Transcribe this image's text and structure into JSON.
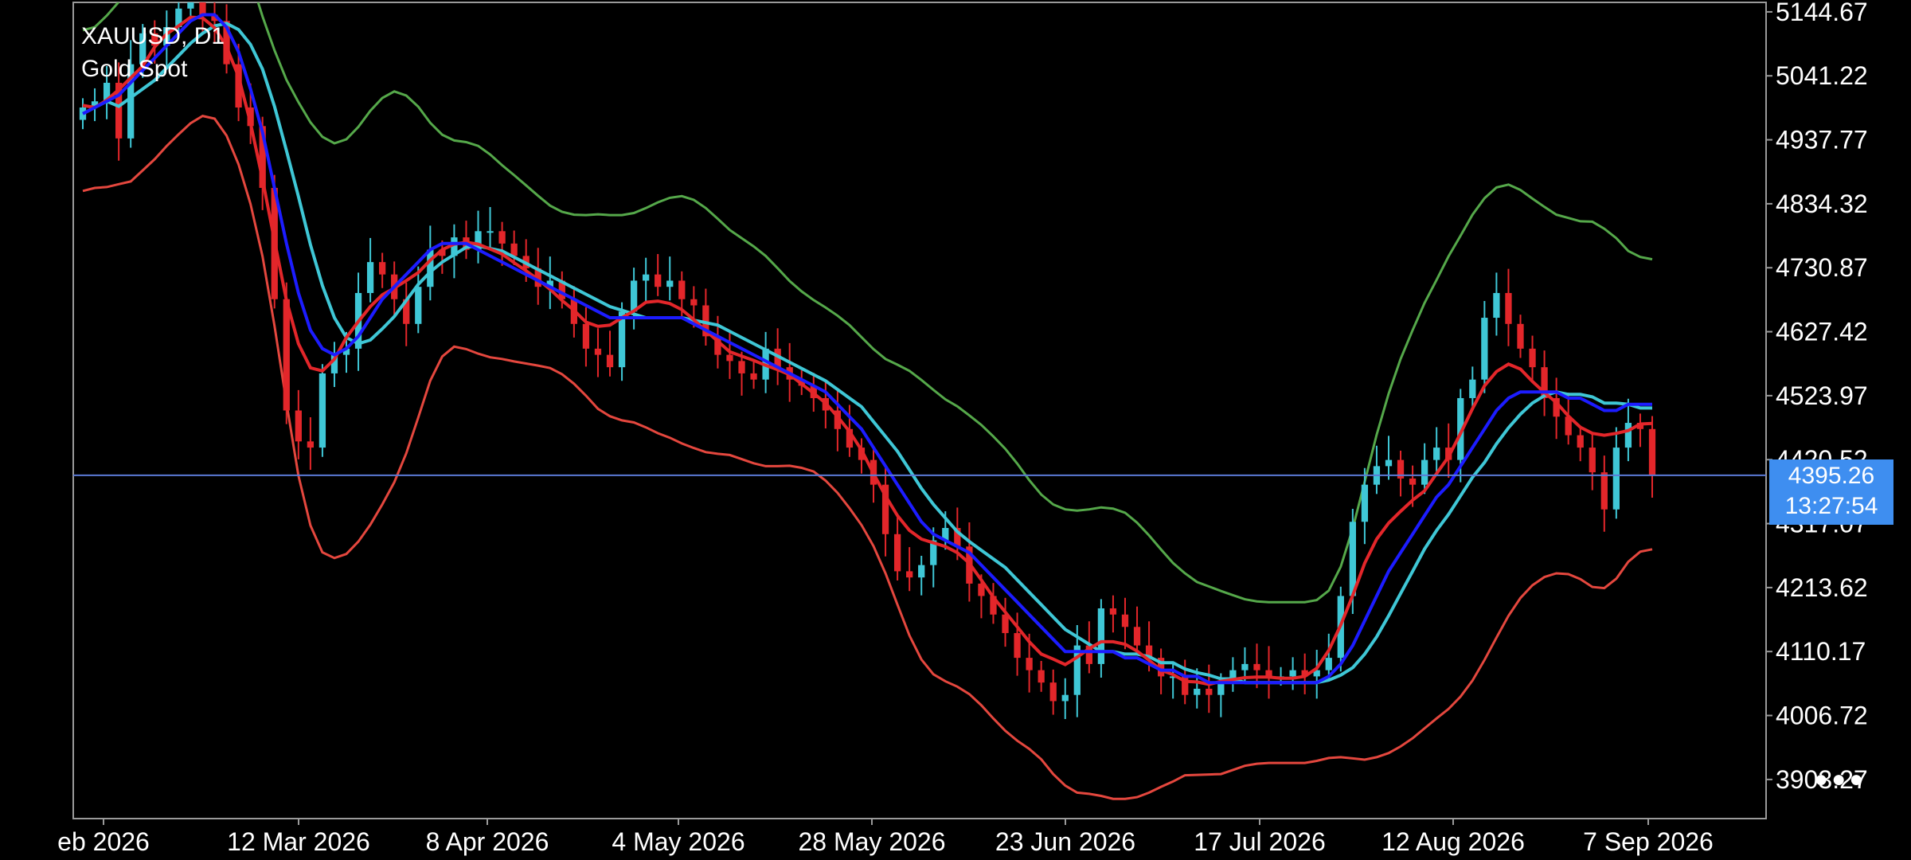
{
  "chart_data": {
    "type": "candlestick",
    "symbol": "XAUUSD, D1",
    "description": "Gold Spot",
    "current_price": "4395.26",
    "countdown": "13:27:54",
    "y_ticks": [
      "5144.67",
      "5041.22",
      "4937.77",
      "4834.32",
      "4730.87",
      "4627.42",
      "4523.97",
      "4420.52",
      "4317.07",
      "4213.62",
      "4110.17",
      "4006.72",
      "3903.27"
    ],
    "x_ticks": [
      "eb 2026",
      "12 Mar 2026",
      "8 Apr 2026",
      "4 May 2026",
      "28 May 2026",
      "23 Jun 2026",
      "17 Jul 2026",
      "12 Aug 2026",
      "7 Sep 2026"
    ],
    "ylim": [
      3840,
      5160
    ],
    "colors": {
      "up": "#3fc7d6",
      "down": "#e3262a",
      "ma_blue": "#1c1cff",
      "ma_red": "#e3262a",
      "ma_cyan": "#3fc7d6",
      "band_upper": "#55a84a",
      "band_lower": "#e4473e",
      "price_line": "#5b7ad6",
      "axis": "#9a9a9a"
    },
    "closes": [
      4990,
      5000,
      5030,
      4940,
      5060,
      5110,
      5090,
      5120,
      5150,
      5170,
      5140,
      5130,
      5060,
      4990,
      4960,
      4860,
      4680,
      4500,
      4450,
      4440,
      4560,
      4590,
      4600,
      4690,
      4740,
      4720,
      4680,
      4640,
      4700,
      4760,
      4750,
      4780,
      4760,
      4790,
      4790,
      4770,
      4750,
      4730,
      4700,
      4710,
      4680,
      4640,
      4600,
      4590,
      4570,
      4660,
      4710,
      4720,
      4700,
      4710,
      4680,
      4670,
      4620,
      4590,
      4580,
      4560,
      4550,
      4600,
      4570,
      4550,
      4540,
      4520,
      4500,
      4470,
      4440,
      4420,
      4380,
      4300,
      4240,
      4230,
      4250,
      4290,
      4310,
      4280,
      4220,
      4200,
      4170,
      4140,
      4100,
      4080,
      4060,
      4030,
      4040,
      4120,
      4090,
      4180,
      4170,
      4150,
      4120,
      4100,
      4070,
      4070,
      4040,
      4050,
      4040,
      4060,
      4080,
      4090,
      4080,
      4070,
      4070,
      4080,
      4070,
      4080,
      4100,
      4200,
      4320,
      4380,
      4410,
      4420,
      4390,
      4380,
      4420,
      4440,
      4420,
      4520,
      4550,
      4650,
      4690,
      4640,
      4600,
      4570,
      4520,
      4490,
      4460,
      4440,
      4400,
      4340,
      4440,
      4480,
      4470,
      4395
    ],
    "ma_blue": [
      4980,
      4990,
      5000,
      5010,
      5030,
      5050,
      5070,
      5090,
      5110,
      5130,
      5140,
      5140,
      5120,
      5080,
      5020,
      4950,
      4860,
      4770,
      4690,
      4630,
      4600,
      4590,
      4600,
      4620,
      4650,
      4680,
      4700,
      4720,
      4740,
      4760,
      4770,
      4770,
      4770,
      4760,
      4750,
      4740,
      4730,
      4720,
      4710,
      4700,
      4690,
      4680,
      4670,
      4660,
      4650,
      4650,
      4650,
      4650,
      4650,
      4650,
      4650,
      4640,
      4630,
      4620,
      4610,
      4600,
      4590,
      4580,
      4570,
      4560,
      4550,
      4540,
      4530,
      4510,
      4490,
      4470,
      4440,
      4410,
      4380,
      4350,
      4320,
      4300,
      4290,
      4280,
      4270,
      4250,
      4230,
      4210,
      4190,
      4170,
      4150,
      4130,
      4110,
      4110,
      4110,
      4110,
      4110,
      4100,
      4100,
      4090,
      4080,
      4080,
      4070,
      4070,
      4060,
      4060,
      4060,
      4060,
      4060,
      4060,
      4060,
      4060,
      4060,
      4060,
      4070,
      4090,
      4120,
      4160,
      4200,
      4240,
      4270,
      4300,
      4330,
      4360,
      4380,
      4410,
      4440,
      4470,
      4500,
      4520,
      4530,
      4530,
      4530,
      4530,
      4520,
      4520,
      4510,
      4500,
      4500,
      4510,
      4510,
      4510
    ]
  }
}
